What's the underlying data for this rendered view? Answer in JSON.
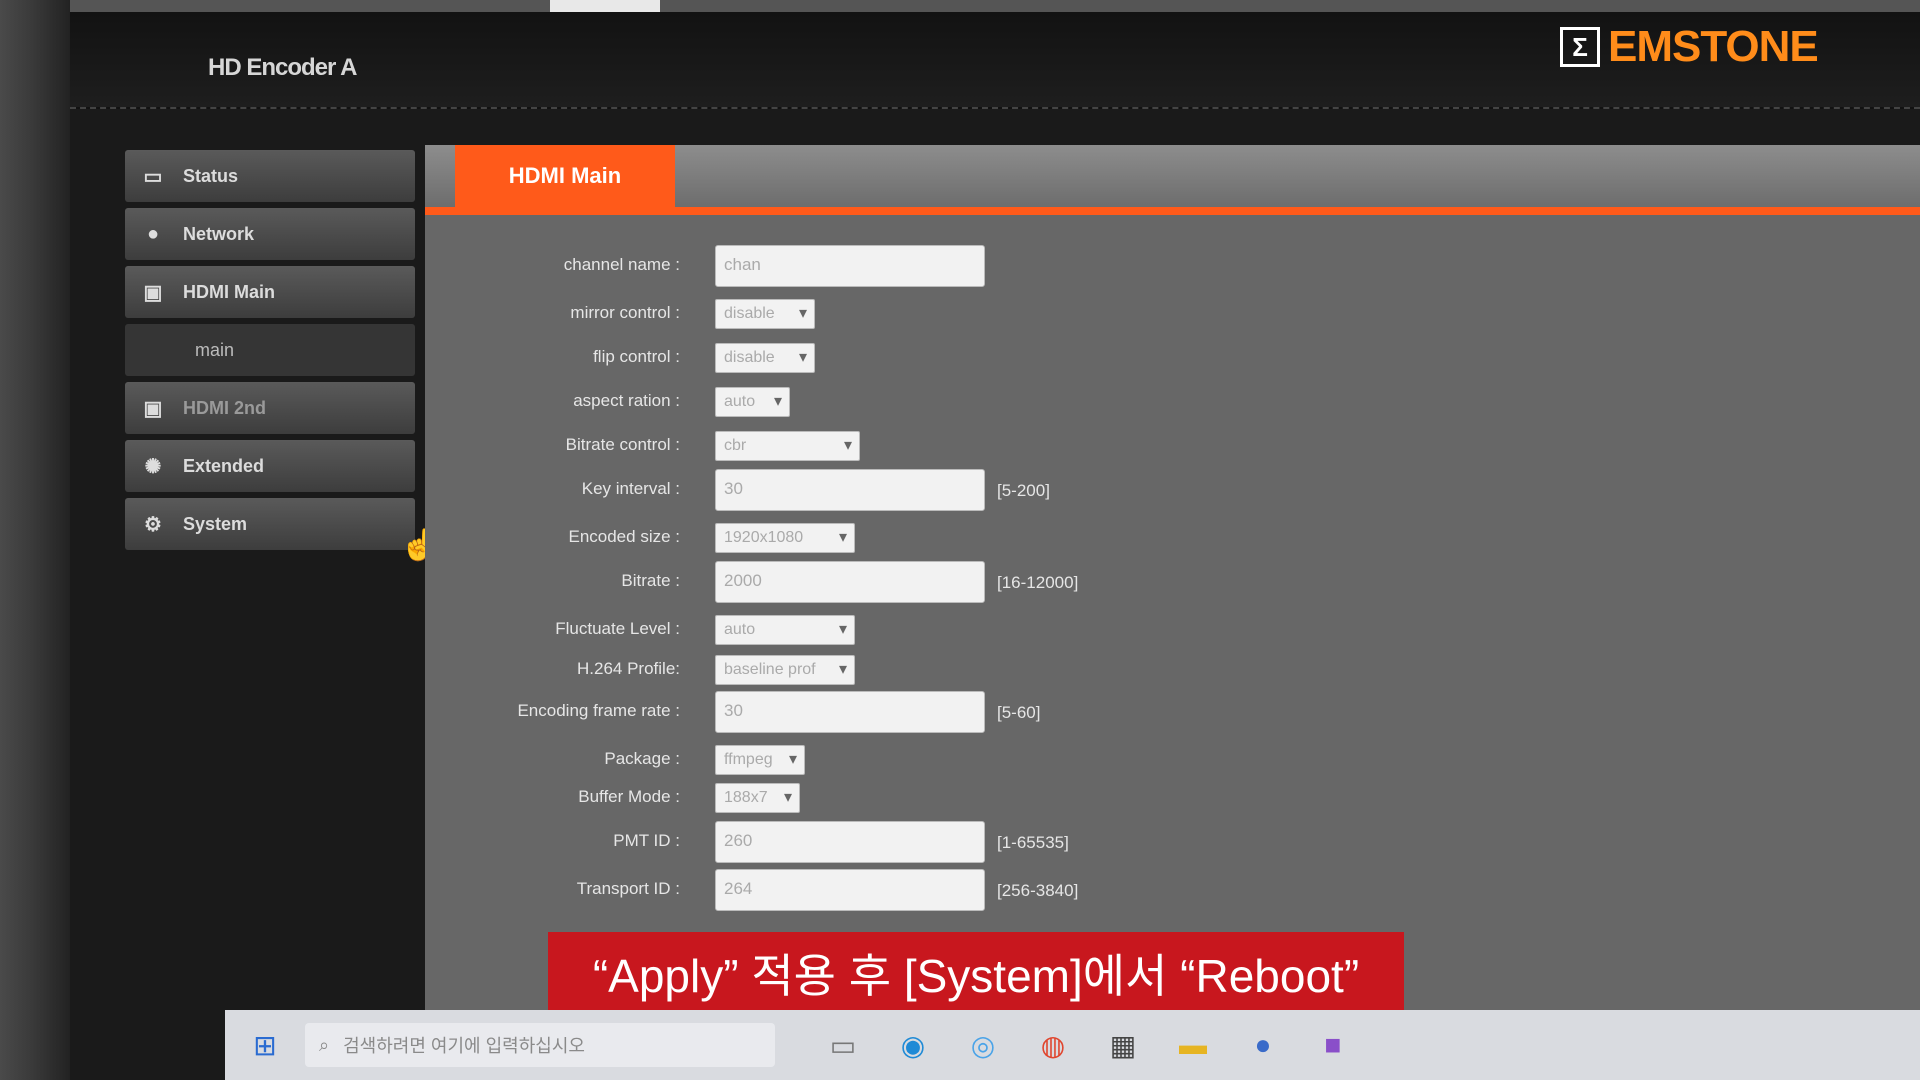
{
  "app": {
    "title": "HD Encoder A"
  },
  "brand": {
    "logo_glyph": "Σ",
    "name": "EMSTONE",
    "accent": "#ff8c1a"
  },
  "sidebar": {
    "items": [
      {
        "label": "Status",
        "icon": "monitor-icon"
      },
      {
        "label": "Network",
        "icon": "globe-icon"
      },
      {
        "label": "HDMI Main",
        "icon": "hdmi-icon"
      },
      {
        "label": "main"
      },
      {
        "label": "HDMI 2nd",
        "icon": "hdmi-icon"
      },
      {
        "label": "Extended",
        "icon": "extended-icon"
      },
      {
        "label": "System",
        "icon": "gear-icon"
      }
    ]
  },
  "tab": {
    "label": "HDMI Main",
    "color": "#ff5a1a"
  },
  "form": {
    "channel_name": {
      "label": "channel name :",
      "value": "chan"
    },
    "mirror_control": {
      "label": "mirror control :",
      "value": "disable"
    },
    "flip_control": {
      "label": "flip control :",
      "value": "disable"
    },
    "aspect_ration": {
      "label": "aspect ration :",
      "value": "auto"
    },
    "bitrate_control": {
      "label": "Bitrate control :",
      "value": "cbr"
    },
    "key_interval": {
      "label": "Key interval :",
      "value": "30",
      "range": "[5-200]"
    },
    "encoded_size": {
      "label": "Encoded size :",
      "value": "1920x1080"
    },
    "bitrate": {
      "label": "Bitrate :",
      "value": "2000",
      "range": "[16-12000]"
    },
    "fluctuate_level": {
      "label": "Fluctuate Level :",
      "value": "auto"
    },
    "h264_profile": {
      "label": "H.264 Profile:",
      "value": "baseline prof"
    },
    "encoding_frame_rate": {
      "label": "Encoding frame rate :",
      "value": "30",
      "range": "[5-60]"
    },
    "package": {
      "label": "Package :",
      "value": "ffmpeg"
    },
    "buffer_mode": {
      "label": "Buffer Mode :",
      "value": "188x7"
    },
    "pmt_id": {
      "label": "PMT ID :",
      "value": "260",
      "range": "[1-65535]"
    },
    "transport_id": {
      "label": "Transport ID :",
      "value": "264",
      "range": "[256-3840]"
    }
  },
  "subtitle": {
    "text": "“Apply” 적용 후 [System]에서 “Reboot”",
    "bg": "#c8171e"
  },
  "taskbar": {
    "search_placeholder": "검색하려면 여기에 입력하십시오",
    "icons": [
      "task-view-icon",
      "edge-icon",
      "browser-icon",
      "chrome-icon",
      "store-icon",
      "explorer-icon",
      "app-icon",
      "app-icon-2"
    ]
  }
}
